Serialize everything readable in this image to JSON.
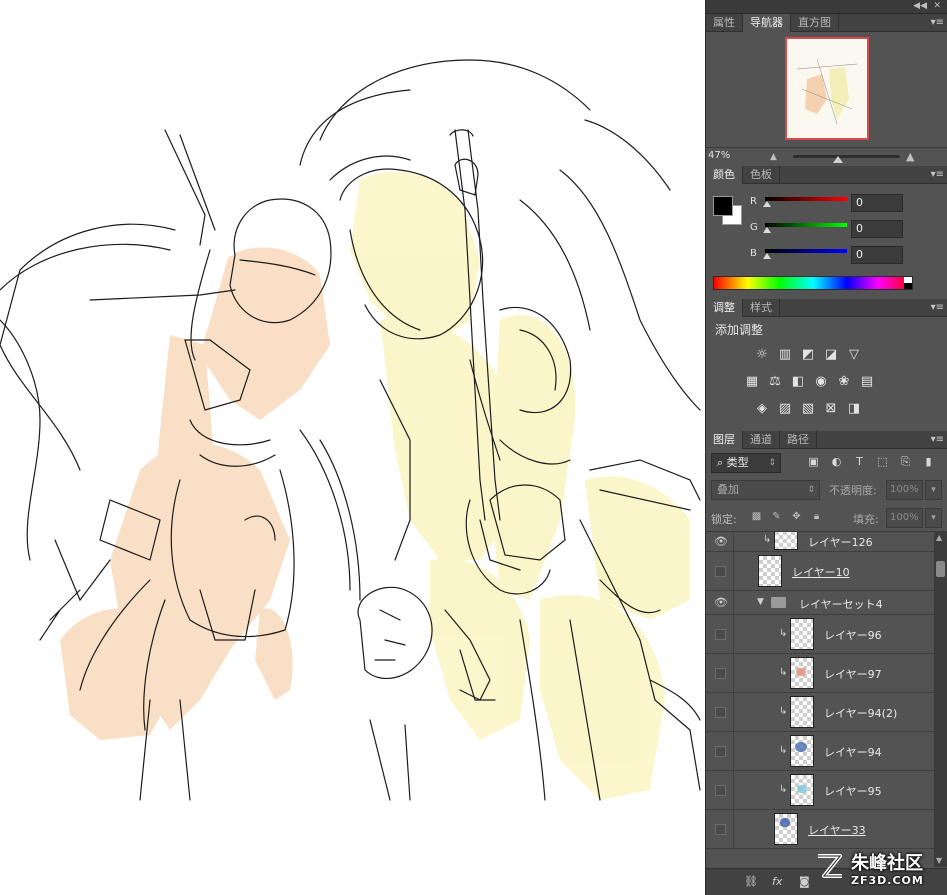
{
  "navigator_group": {
    "tabs": [
      "属性",
      "导航器",
      "直方图"
    ],
    "active_tab": "导航器",
    "zoom": "47%"
  },
  "color_group": {
    "tabs": [
      "颜色",
      "色板"
    ],
    "active_tab": "颜色",
    "foreground": "#000000",
    "background": "#ffffff",
    "channels": [
      {
        "label": "R",
        "value": "0"
      },
      {
        "label": "G",
        "value": "0"
      },
      {
        "label": "B",
        "value": "0"
      }
    ]
  },
  "adjust_group": {
    "tabs": [
      "调整",
      "样式"
    ],
    "active_tab": "调整",
    "title": "添加调整"
  },
  "layers_group": {
    "tabs": [
      "图层",
      "通道",
      "路径"
    ],
    "active_tab": "图层",
    "filter_kind": "类型",
    "blend_mode": "叠加",
    "opacity_label": "不透明度:",
    "opacity_value": "100%",
    "lock_label": "锁定:",
    "fill_label": "填充:",
    "fill_value": "100%",
    "layers": [
      {
        "name": "レイヤー126",
        "visible": true,
        "clipped": true,
        "kind": "partial"
      },
      {
        "name": "レイヤー10",
        "visible": false,
        "clipped": false,
        "kind": "layer"
      },
      {
        "name": "レイヤーセット4",
        "visible": true,
        "clipped": false,
        "kind": "group"
      },
      {
        "name": "レイヤー96",
        "visible": false,
        "clipped": true,
        "kind": "layer"
      },
      {
        "name": "レイヤー97",
        "visible": false,
        "clipped": true,
        "kind": "layer"
      },
      {
        "name": "レイヤー94(2)",
        "visible": false,
        "clipped": true,
        "kind": "layer"
      },
      {
        "name": "レイヤー94",
        "visible": false,
        "clipped": true,
        "kind": "layer"
      },
      {
        "name": "レイヤー95",
        "visible": false,
        "clipped": true,
        "kind": "layer"
      },
      {
        "name": "レイヤー33",
        "visible": false,
        "clipped": false,
        "kind": "layer"
      }
    ]
  },
  "watermark": {
    "name": "朱峰社区",
    "site": "ZF3D.COM"
  },
  "colors": {
    "panel_bg": "#535353",
    "tab_bg": "#424242",
    "skin_fill": "#f9dcc0",
    "hair_fill": "#fbf6c8",
    "line": "#1c1c1c"
  }
}
